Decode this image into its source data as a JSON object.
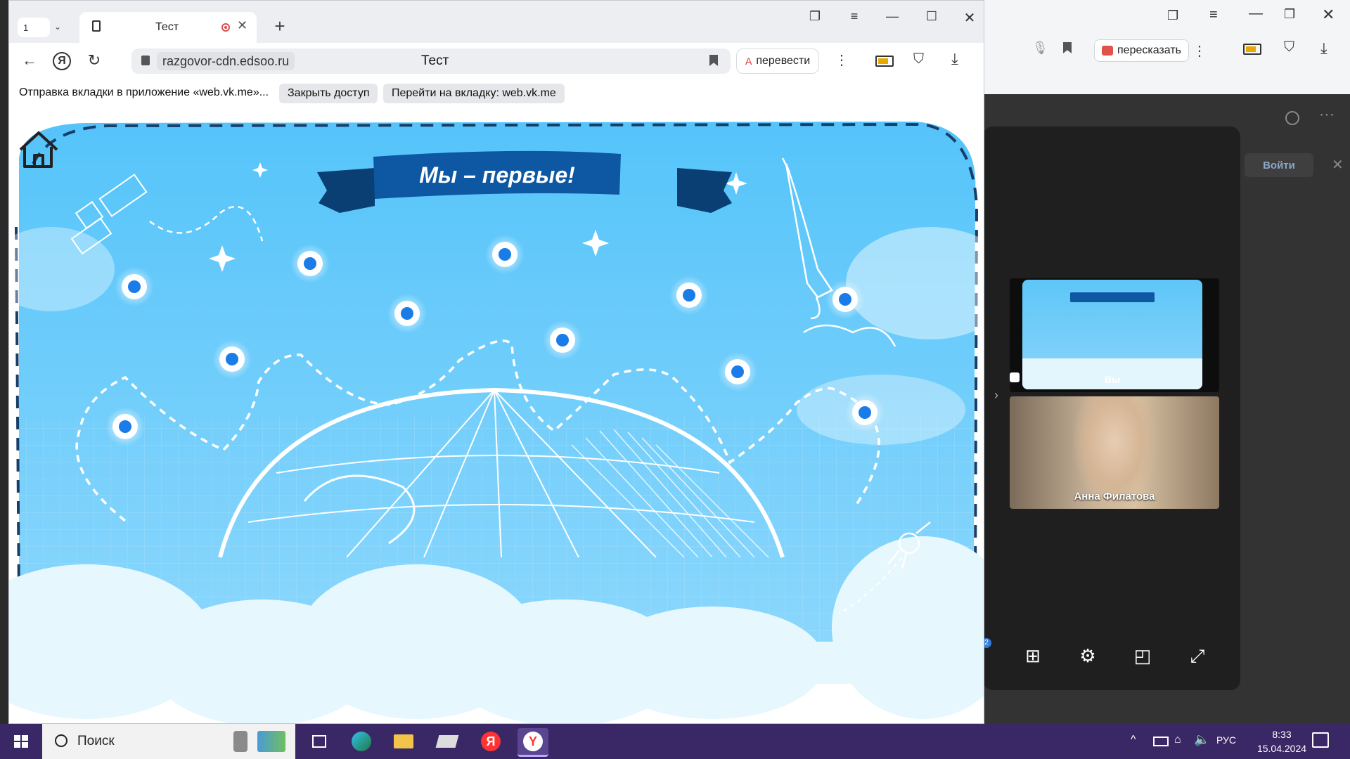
{
  "browser": {
    "tab_count": "1",
    "tab_title": "Тест",
    "url": "razgovor-cdn.edsoo.ru",
    "page_title": "Тест",
    "translate_label": "перевести"
  },
  "share_bar": {
    "text": "Отправка вкладки в приложение «web.vk.me»...",
    "close_access": "Закрыть доступ",
    "goto_tab": "Перейти на вкладку: web.vk.me"
  },
  "slide": {
    "banner": "Мы – первые!"
  },
  "background_window": {
    "retell_label": "пересказать",
    "login_label": "Войти"
  },
  "call": {
    "self_label": "Вы",
    "participant_name": "Анна Филатова",
    "badge_count": "2"
  },
  "taskbar": {
    "search_label": "Поиск",
    "language": "РУС",
    "time": "8:33",
    "date": "15.04.2024"
  },
  "colors": {
    "sky": "#5cc8fb",
    "banner": "#0e57a3",
    "node": "#1a7ce8",
    "taskbar": "#3a2766"
  }
}
